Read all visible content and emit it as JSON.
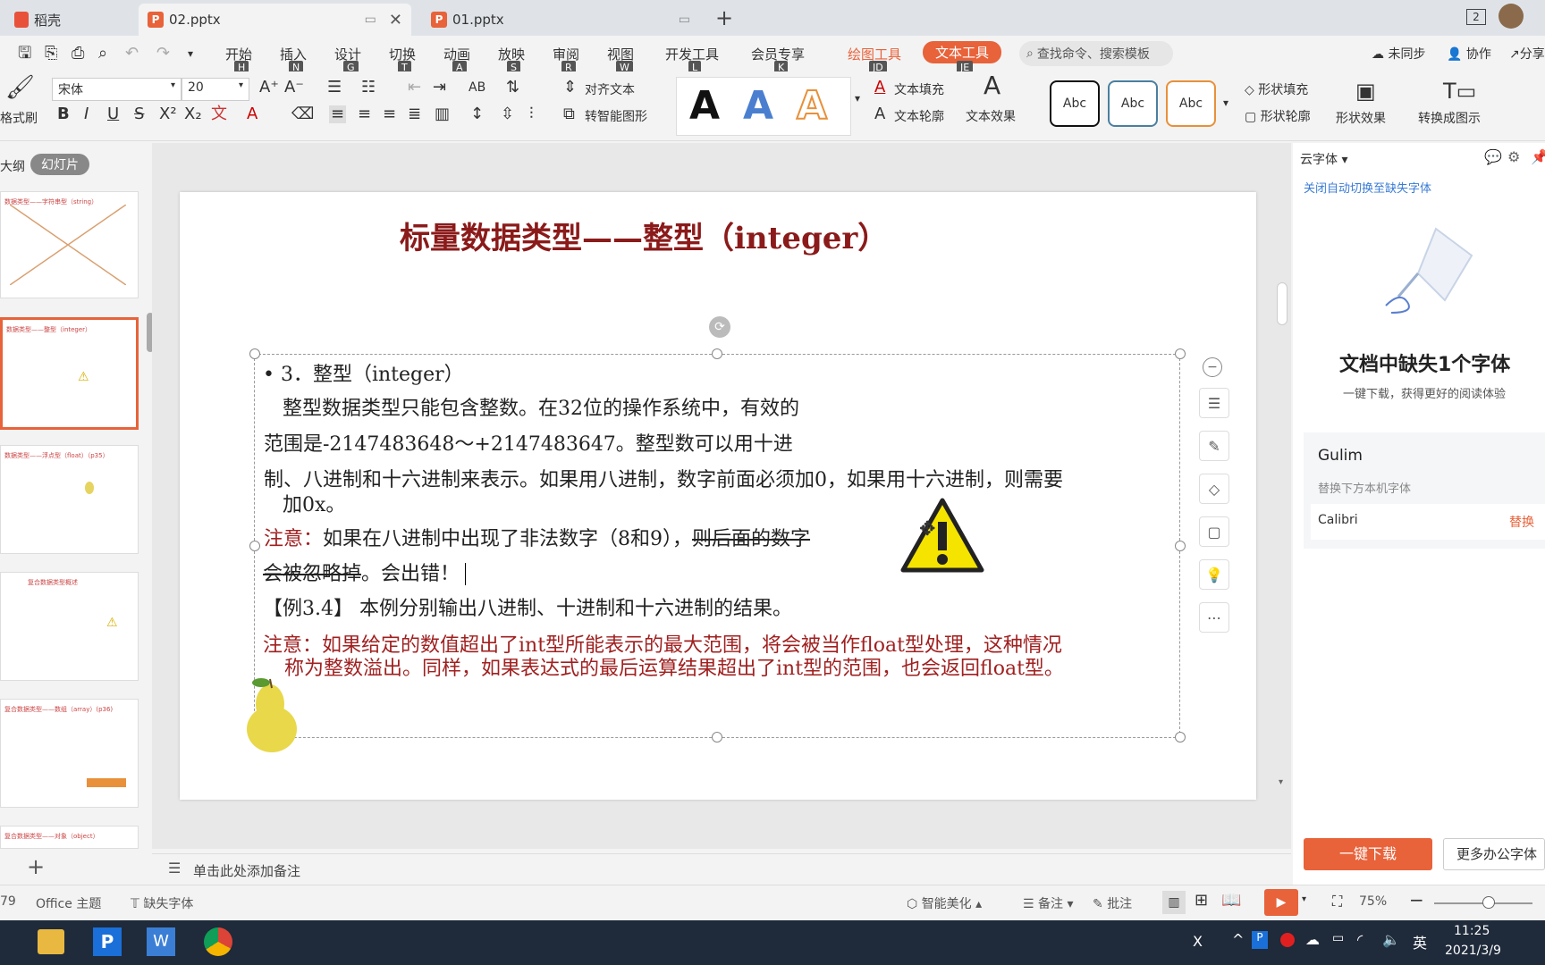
{
  "tabs": [
    {
      "label": "稻壳"
    },
    {
      "label": "02.pptx"
    },
    {
      "label": "01.pptx"
    }
  ],
  "tabbar_badge": "2",
  "menu": [
    {
      "label": "开始",
      "key": "H"
    },
    {
      "label": "插入",
      "key": "N"
    },
    {
      "label": "设计",
      "key": "G"
    },
    {
      "label": "切换",
      "key": "T"
    },
    {
      "label": "动画",
      "key": "A"
    },
    {
      "label": "放映",
      "key": "S"
    },
    {
      "label": "审阅",
      "key": "R"
    },
    {
      "label": "视图",
      "key": "W"
    },
    {
      "label": "开发工具",
      "key": "L"
    },
    {
      "label": "会员专享",
      "key": "K"
    },
    {
      "label": "绘图工具",
      "key": "JD"
    },
    {
      "label": "文本工具",
      "key": "JE"
    }
  ],
  "search_placeholder": "查找命令、搜索模板",
  "top_right": {
    "sync": "未同步",
    "collab": "协作",
    "share": "分享"
  },
  "toolbar": {
    "format_brush": "格式刷",
    "font_name": "宋体",
    "font_size": "20",
    "align_text": "对齐文本",
    "smart_shape": "转智能图形",
    "text_fill": "文本填充",
    "text_outline": "文本轮廓",
    "text_effect": "文本效果",
    "abc": "Abc",
    "shape_fill": "形状填充",
    "shape_outline": "形状轮廓",
    "shape_effect": "形状效果",
    "convert_chart": "转换成图示"
  },
  "left_tabs": {
    "outline": "大纲",
    "slides": "幻灯片"
  },
  "thumbs": [
    {
      "title": "数据类型——字符串型（string）"
    },
    {
      "title": "数据类型——整型（integer）"
    },
    {
      "title": "数据类型——浮点型（float）（p35）"
    },
    {
      "title": "复合数据类型概述"
    },
    {
      "title": "复合数据类型——数组（array）(p36)"
    },
    {
      "title": "复合数据类型——对象（object）"
    }
  ],
  "slide": {
    "title": "标量数据类型——整型（integer）",
    "bullet": "• 3．整型（integer）",
    "line1": "整型数据类型只能包含整数。在32位的操作系统中，有效的",
    "line2": "范围是-2147483648～+2147483647。整型数可以用十进",
    "line3": "制、八进制和十六进制来表示。如果用八进制，数字前面必须加0，如果用十六进制，则需要",
    "line3b": "加0x。",
    "note1_label": "注意：",
    "note1_text": "如果在八进制中出现了非法数字（8和9），",
    "note1_strike": "则后面的数字",
    "line5_strike": "会被忽略掉",
    "line5_rest": "。会出错！",
    "example": "【例3.4】 本例分别输出八进制、十进制和十六进制的结果。",
    "note2_line1": "注意：如果给定的数值超出了int型所能表示的最大范围，将会被当作float型处理，这种情况",
    "note2_line2": "称为整数溢出。同样，如果表达式的最后运算结果超出了int型的范围，也会返回float型。"
  },
  "notes_placeholder": "单击此处添加备注",
  "right_pane": {
    "header": "云字体",
    "link": "关闭自动切换至缺失字体",
    "missing_title": "文档中缺失1个字体",
    "missing_sub": "一键下载，获得更好的阅读体验",
    "font_missing": "Gulim",
    "replace_hint": "替换下方本机字体",
    "replace_font": "Calibri",
    "replace_action": "替换",
    "download_btn": "一键下载",
    "more_btn": "更多办公字体"
  },
  "status": {
    "page": "79",
    "theme": "Office 主题",
    "missing_font": "缺失字体",
    "beautify": "智能美化",
    "notes": "备注",
    "comments": "批注",
    "zoom": "75%"
  },
  "taskbar": {
    "time": "11:25",
    "date": "2021/3/9",
    "ime": "英"
  },
  "colors": {
    "accent": "#e8623a",
    "slide_title": "#8b1a1a",
    "note_red": "#a02020"
  }
}
